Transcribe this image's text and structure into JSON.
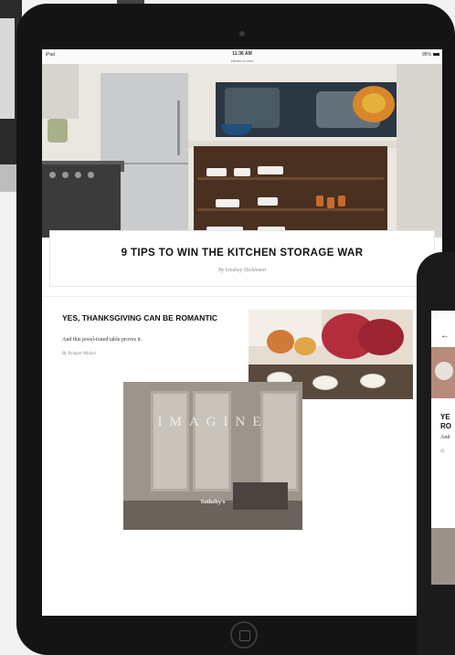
{
  "status_bar": {
    "carrier": "iPad",
    "time": "11:36 AM",
    "url": "elledecor.com",
    "battery": "95%"
  },
  "hero": {
    "headline": "9 TIPS TO WIN THE KITCHEN STORAGE WAR",
    "byline": "By Lindsey Dickinson"
  },
  "article": {
    "title": "YES, THANKSGIVING CAN BE ROMANTIC",
    "summary": "And this jewel-toned table proves it.",
    "byline": "By Bridget Mullen"
  },
  "ad": {
    "headline": "IMAGINE",
    "brand": "Sotheby's"
  },
  "phone": {
    "back_glyph": "←",
    "title_fragment": "YE\nRO",
    "summary_fragment": "And",
    "byline_fragment": "By"
  },
  "colors": {
    "device_body": "#141414",
    "screen_bg": "#ffffff",
    "headline_text": "#111111",
    "byline_text": "#888888"
  }
}
